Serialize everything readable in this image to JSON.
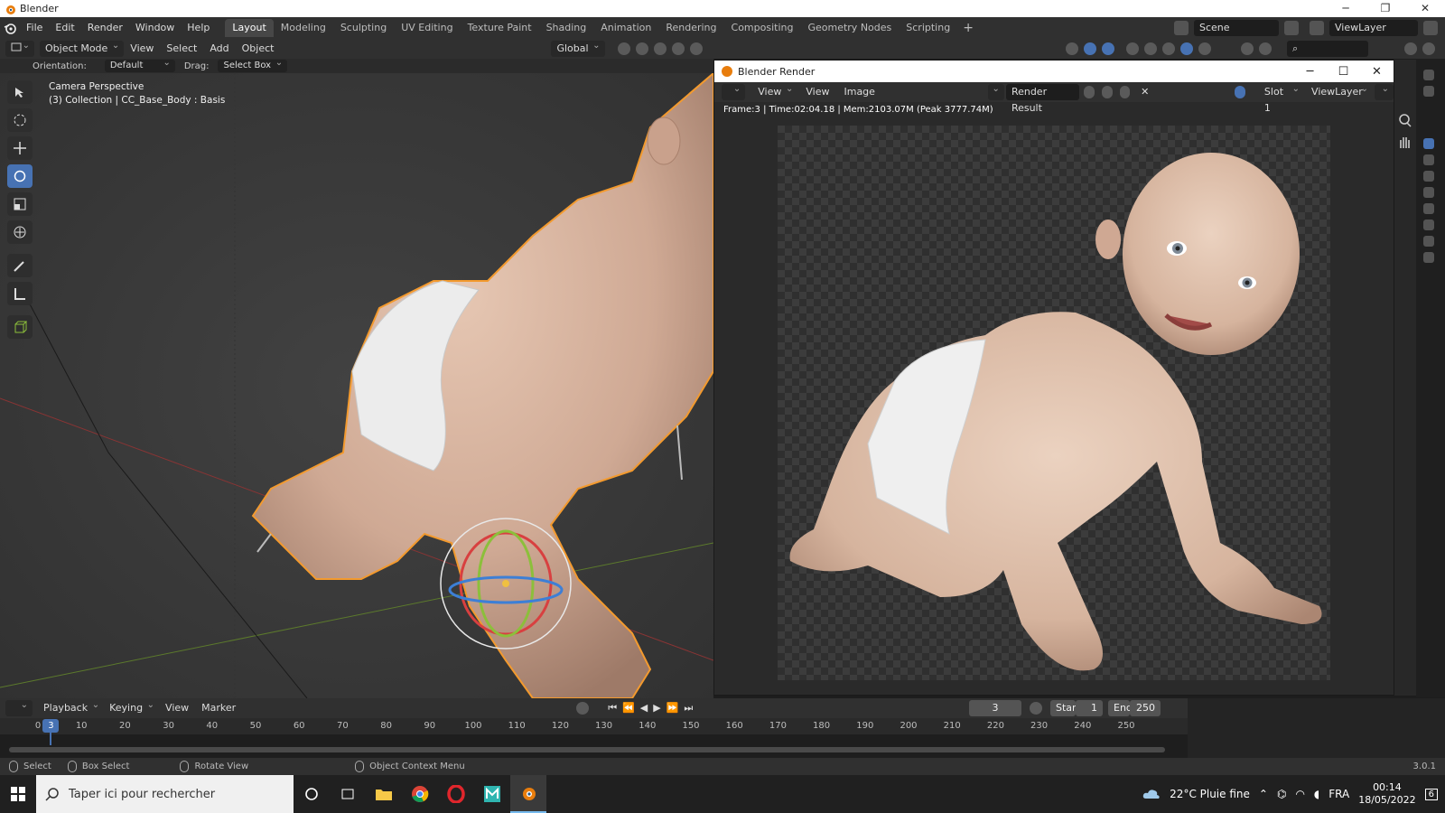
{
  "os": {
    "window_title": "Blender",
    "minimize": "─",
    "maximize": "❐",
    "close": "✕"
  },
  "menu": [
    "File",
    "Edit",
    "Render",
    "Window",
    "Help"
  ],
  "workspaces": [
    "Layout",
    "Modeling",
    "Sculpting",
    "UV Editing",
    "Texture Paint",
    "Shading",
    "Animation",
    "Rendering",
    "Compositing",
    "Geometry Nodes",
    "Scripting"
  ],
  "workspace_add": "+",
  "scene": {
    "name": "Scene",
    "view_layer": "ViewLayer"
  },
  "viewport_header": {
    "mode": "Object Mode",
    "menus": [
      "View",
      "Select",
      "Add",
      "Object"
    ],
    "transform_orientation": "Global"
  },
  "tool_settings": {
    "orientation_label": "Orientation:",
    "orientation_value": "Default",
    "drag_label": "Drag:",
    "drag_value": "Select Box"
  },
  "viewport_overlay": {
    "line1": "Camera Perspective",
    "line2": "(3) Collection | CC_Base_Body : Basis"
  },
  "render_window": {
    "title": "Blender Render",
    "menus": [
      "View",
      "View",
      "Image"
    ],
    "image_name": "Render Result",
    "slot": "Slot 1",
    "view_layer": "ViewLayer",
    "info": "Frame:3 | Time:02:04.18 | Mem:2103.07M (Peak 3777.74M)"
  },
  "timeline": {
    "menus": [
      "Playback",
      "Keying",
      "View",
      "Marker"
    ],
    "current_frame": "3",
    "start_label": "Start",
    "start": "1",
    "end_label": "End",
    "end": "250",
    "ticks": [
      "0",
      "10",
      "20",
      "30",
      "40",
      "50",
      "60",
      "70",
      "80",
      "90",
      "100",
      "110",
      "120",
      "130",
      "140",
      "150",
      "160",
      "170",
      "180",
      "190",
      "200",
      "210",
      "220",
      "230",
      "240",
      "250"
    ]
  },
  "status_bar": {
    "select": "Select",
    "box_select": "Box Select",
    "rotate_view": "Rotate View",
    "context_menu": "Object Context Menu",
    "version": "3.0.1"
  },
  "taskbar": {
    "search_placeholder": "Taper ici pour rechercher",
    "weather": "22°C  Pluie fine",
    "language": "FRA",
    "time": "00:14",
    "date": "18/05/2022",
    "notifications": "6"
  },
  "colors": {
    "accent": "#4772b3",
    "selection_outline": "#f39a2e",
    "skin": "#d9b7a0"
  }
}
